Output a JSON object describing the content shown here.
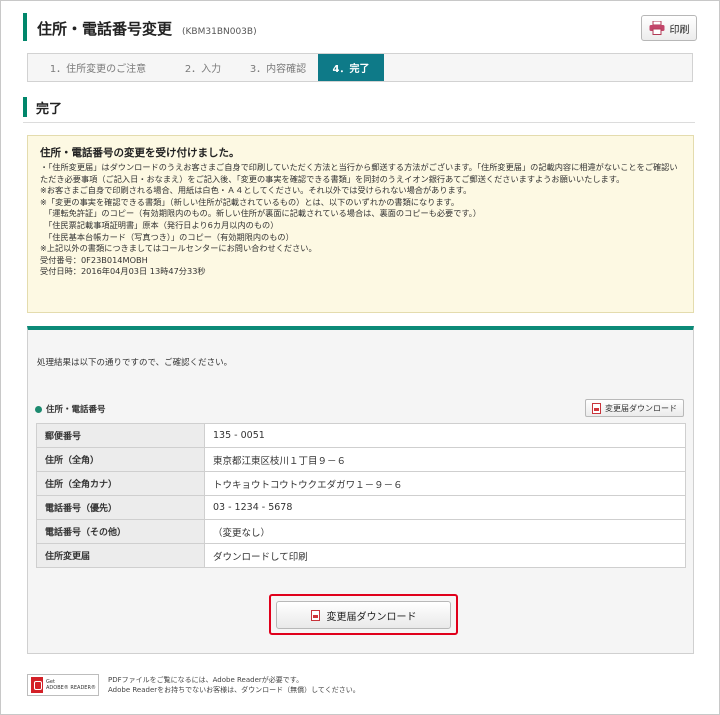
{
  "header": {
    "title": "住所・電話番号変更",
    "code": "(KBM31BN003B)",
    "print_label": "印刷"
  },
  "steps": [
    {
      "label": "1．住所変更のご注意"
    },
    {
      "label": "2．入力"
    },
    {
      "label": "3．内容確認"
    },
    {
      "label": "4．完了"
    }
  ],
  "section": {
    "title": "完了"
  },
  "notice": {
    "heading": "住所・電話番号の変更を受け付けました。",
    "paragraph": "・「住所変更届」はダウンロードのうえお客さまご自身で印刷していただく方法と当行から郵送する方法がございます。「住所変更届」の記載内容に相違がないことをご確認いただき必要事項（ご記入日・おなまえ）をご記入後、「変更の事実を確認できる書類」を同封のうえイオン銀行あてご郵送くださいますようお願いいたします。",
    "lines": [
      "※お客さまご自身で印刷される場合、用紙は白色・Ａ４としてください。それ以外では受けられない場合があります。",
      "※「変更の事実を確認できる書類」（新しい住所が記載されているもの）とは、以下のいずれかの書類になります。",
      "　「運転免許証」のコピー（有効期限内のもの。新しい住所が裏面に記載されている場合は、裏面のコピーも必要です。）",
      "　「住民票記載事項証明書」原本（発行日より6カ月以内のもの）",
      "　「住民基本台帳カード（写真つき）」のコピー（有効期限内のもの）",
      "※上記以外の書類につきましてはコールセンターにお問い合わせください。",
      "受付番号：0F23B014MOBH",
      "受付日時：2016年04月03日 13時47分33秒"
    ]
  },
  "result": {
    "intro": "処理結果は以下の通りですので、ご確認ください。",
    "subtitle": "住所・電話番号",
    "small_download_label": "変更届ダウンロード",
    "rows": [
      {
        "key": "郵便番号",
        "value": "135 - 0051"
      },
      {
        "key": "住所（全角）",
        "value": "東京都江東区枝川１丁目９－６"
      },
      {
        "key": "住所（全角カナ）",
        "value": "トウキョウトコウトウクエダガワ１－９－６"
      },
      {
        "key": "電話番号（優先）",
        "value": "03 - 1234 - 5678"
      },
      {
        "key": "電話番号（その他）",
        "value": "（変更なし）"
      },
      {
        "key": "住所変更届",
        "value": "ダウンロードして印刷"
      }
    ],
    "big_download_label": "変更届ダウンロード"
  },
  "footer": {
    "badge_line1": "Get",
    "badge_line2": "ADOBE® READER®",
    "note_line1": "PDFファイルをご覧になるには、Adobe Readerが必要です。",
    "note_line2": "Adobe Readerをお持ちでないお客様は、ダウンロード（無償）してください。"
  },
  "colors": {
    "accent": "#00866b",
    "step_active": "#0e7a88",
    "notice_bg": "#fdf9e3",
    "highlight": "#e0001b"
  }
}
